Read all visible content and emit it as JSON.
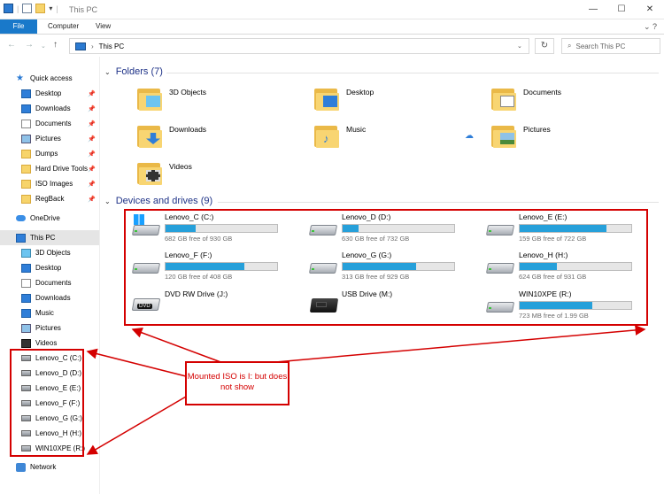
{
  "window": {
    "title": "This PC",
    "controls": [
      "—",
      "☐",
      "✕"
    ]
  },
  "ribbon": {
    "tabs": [
      {
        "label": "File",
        "active": true
      },
      {
        "label": "Computer",
        "active": false
      },
      {
        "label": "View",
        "active": false
      }
    ]
  },
  "address": {
    "path": "This PC",
    "search_placeholder": "Search This PC"
  },
  "nav": {
    "quick_access_label": "Quick access",
    "quick_items": [
      {
        "label": "Desktop",
        "icon": "desktop-icon",
        "pinned": true
      },
      {
        "label": "Downloads",
        "icon": "downloads-icon",
        "pinned": true
      },
      {
        "label": "Documents",
        "icon": "documents-icon",
        "pinned": true
      },
      {
        "label": "Pictures",
        "icon": "pictures-icon",
        "pinned": true
      },
      {
        "label": "Dumps",
        "icon": "folder-icon",
        "pinned": true
      },
      {
        "label": "Hard Drive Tools",
        "icon": "folder-icon",
        "pinned": true
      },
      {
        "label": "ISO Images",
        "icon": "folder-icon",
        "pinned": true
      },
      {
        "label": "RegBack",
        "icon": "folder-icon",
        "pinned": true
      }
    ],
    "onedrive_label": "OneDrive",
    "thispc_label": "This PC",
    "pc_items": [
      {
        "label": "3D Objects",
        "icon": "3d-objects-icon"
      },
      {
        "label": "Desktop",
        "icon": "desktop-icon"
      },
      {
        "label": "Documents",
        "icon": "documents-icon"
      },
      {
        "label": "Downloads",
        "icon": "downloads-icon"
      },
      {
        "label": "Music",
        "icon": "music-icon"
      },
      {
        "label": "Pictures",
        "icon": "pictures-icon"
      },
      {
        "label": "Videos",
        "icon": "videos-icon"
      }
    ],
    "drives": [
      "Lenovo_C (C:)",
      "Lenovo_D (D:)",
      "Lenovo_E (E:)",
      "Lenovo_F (F:)",
      "Lenovo_G (G:)",
      "Lenovo_H (H:)",
      "WIN10XPE (R:)"
    ],
    "network_label": "Network"
  },
  "content": {
    "folders_header": "Folders (7)",
    "folders": [
      {
        "label": "3D Objects",
        "icon": "3d-objects-icon"
      },
      {
        "label": "Desktop",
        "icon": "desktop-icon"
      },
      {
        "label": "Documents",
        "icon": "documents-icon"
      },
      {
        "label": "Downloads",
        "icon": "downloads-icon"
      },
      {
        "label": "Music",
        "icon": "music-icon"
      },
      {
        "label": "Pictures",
        "icon": "pictures-icon"
      },
      {
        "label": "Videos",
        "icon": "videos-icon"
      }
    ],
    "drives_header": "Devices and drives (9)",
    "drives": [
      {
        "name": "Lenovo_C (C:)",
        "free": "682 GB free of 930 GB",
        "used_fraction": 0.27,
        "icon": "windows-drive-icon"
      },
      {
        "name": "Lenovo_D (D:)",
        "free": "630 GB free of 732 GB",
        "used_fraction": 0.14,
        "icon": "hard-drive-icon"
      },
      {
        "name": "Lenovo_E (E:)",
        "free": "159 GB free of 722 GB",
        "used_fraction": 0.78,
        "icon": "hard-drive-icon"
      },
      {
        "name": "Lenovo_F (F:)",
        "free": "120 GB free of 408 GB",
        "used_fraction": 0.71,
        "icon": "hard-drive-icon"
      },
      {
        "name": "Lenovo_G (G:)",
        "free": "313 GB free of 929 GB",
        "used_fraction": 0.66,
        "icon": "hard-drive-icon"
      },
      {
        "name": "Lenovo_H (H:)",
        "free": "624 GB free of 931 GB",
        "used_fraction": 0.33,
        "icon": "hard-drive-icon"
      },
      {
        "name": "DVD RW Drive (J:)",
        "free": null,
        "used_fraction": null,
        "icon": "dvd-drive-icon"
      },
      {
        "name": "USB Drive (M:)",
        "free": null,
        "used_fraction": null,
        "icon": "usb-drive-icon"
      },
      {
        "name": "WIN10XPE (R:)",
        "free": "723 MB free of 1.99 GB",
        "used_fraction": 0.65,
        "icon": "hard-drive-icon"
      }
    ]
  },
  "annotation": {
    "note": "Mounted ISO is I: but does not show",
    "color": "#d40000"
  },
  "colors": {
    "accent": "#1979ca",
    "bar_fill": "#26a0da",
    "header_text": "#1e3287"
  }
}
